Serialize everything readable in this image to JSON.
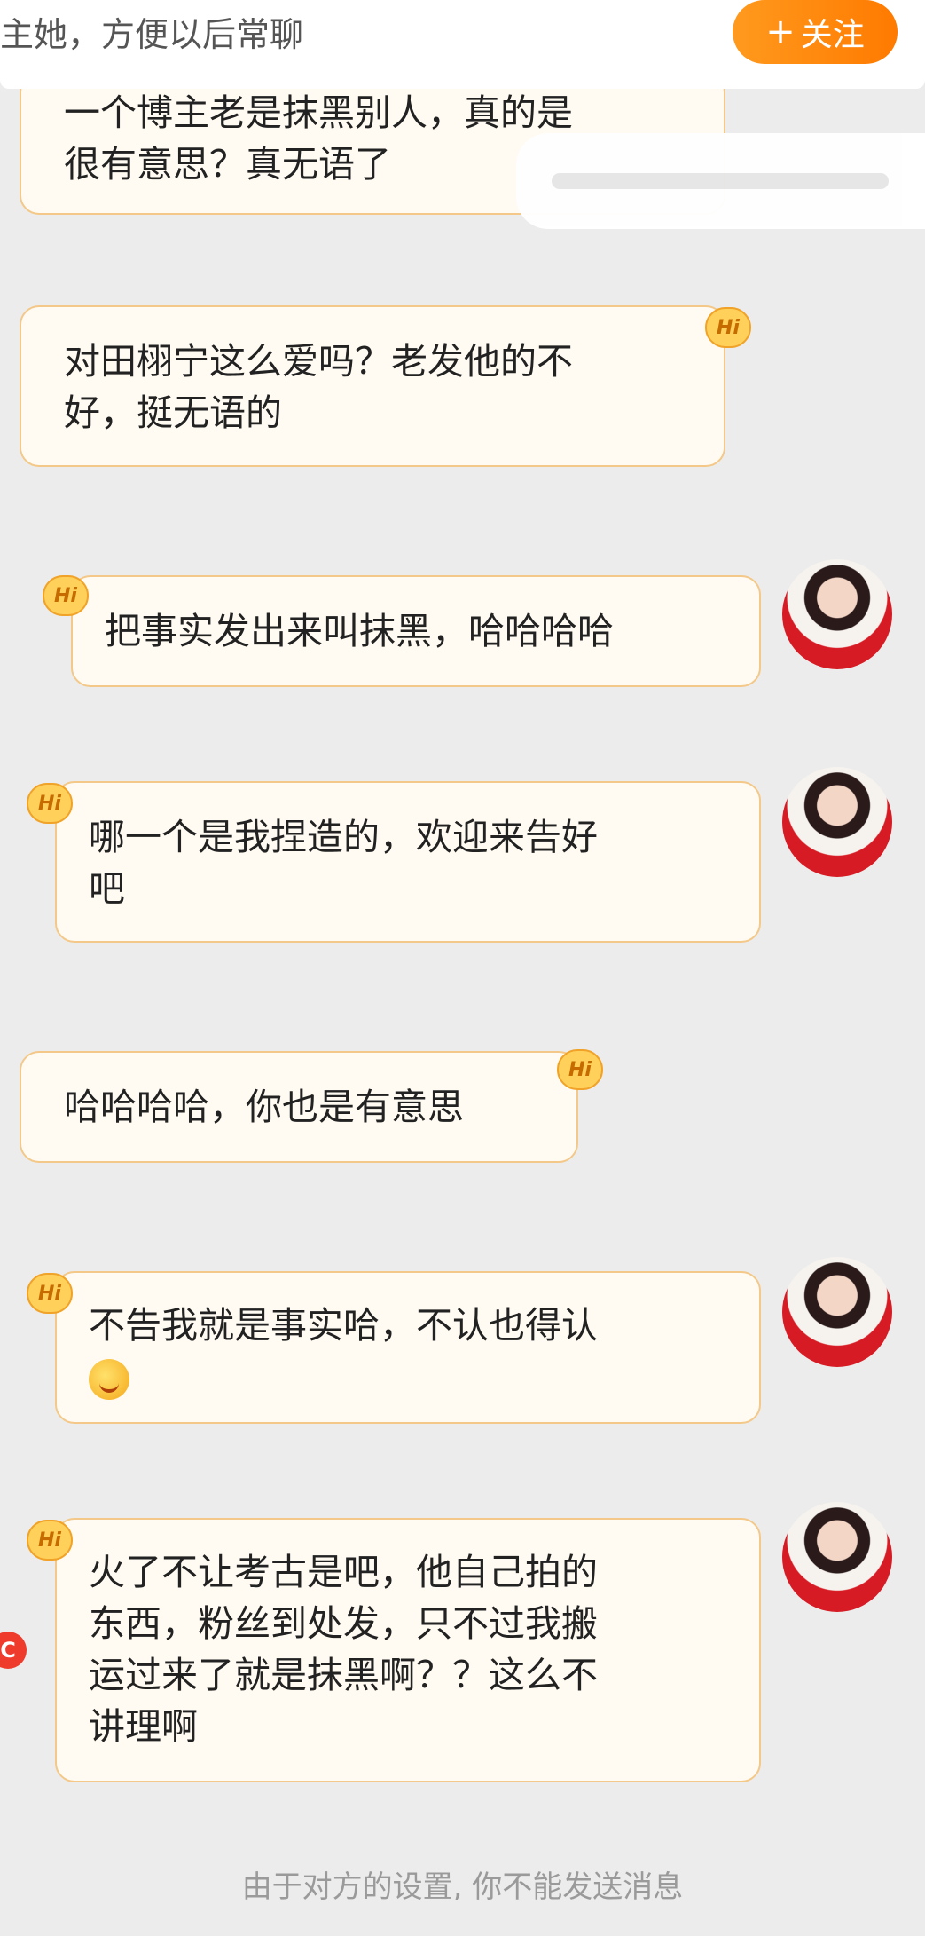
{
  "header": {
    "text": "主她，方便以后常聊",
    "follow_plus": "+",
    "follow_label": "关注"
  },
  "messages": [
    {
      "side": "left",
      "lines": [
        "一个博主老是抹黑别人，真的是",
        "很有意思？真无语了"
      ]
    },
    {
      "side": "left",
      "badge": "Hi",
      "lines": [
        "对田栩宁这么爱吗？老发他的不",
        "好，挺无语的"
      ]
    },
    {
      "side": "right",
      "badge": "Hi",
      "lines": [
        "把事实发出来叫抹黑，哈哈哈哈"
      ]
    },
    {
      "side": "right",
      "badge": "Hi",
      "lines": [
        "哪一个是我捏造的，欢迎来告好",
        "吧"
      ]
    },
    {
      "side": "left",
      "badge": "Hi",
      "lines": [
        "哈哈哈哈，你也是有意思"
      ]
    },
    {
      "side": "right",
      "badge": "Hi",
      "lines": [
        "不告我就是事实哈，不认也得认"
      ],
      "emoji": "wink-tongue-emoji"
    },
    {
      "side": "right",
      "badge": "Hi",
      "lines": [
        "火了不让考古是吧，他自己拍的",
        "东西，粉丝到处发，只不过我搬",
        "运过来了就是抹黑啊？？这么不",
        "讲理啊"
      ]
    }
  ],
  "side_badge": "C",
  "notice": "由于对方的设置, 你不能发送消息",
  "colors": {
    "accent": "#ff8a00",
    "bubble_bg": "#fffbf2",
    "bubble_border": "#f3c889",
    "background": "#ececec"
  }
}
